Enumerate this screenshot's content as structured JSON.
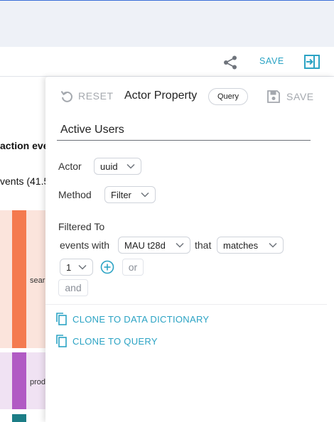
{
  "toolbar": {
    "share_icon": "share-icon",
    "save_label": "SAVE",
    "panel_icon": "panel-collapse-icon"
  },
  "background": {
    "title_fragment": "action eve",
    "subtitle_fragment": "vents (41.5",
    "sankey_labels": [
      "sear",
      "prod"
    ]
  },
  "drawer": {
    "reset_label": "RESET",
    "title": "Actor Property",
    "type_chip": "Query",
    "save_label": "SAVE",
    "name_value": "Active Users",
    "actor_label": "Actor",
    "actor_value": "uuid",
    "method_label": "Method",
    "method_value": "Filter",
    "filtered_to_label": "Filtered To",
    "events_with_label": "events with",
    "event_value": "MAU t28d",
    "that_label": "that",
    "operator_value": "matches",
    "count_value": "1",
    "or_label": "or",
    "and_label": "and",
    "clone_dictionary_label": "CLONE TO DATA DICTIONARY",
    "clone_query_label": "CLONE TO QUERY"
  },
  "colors": {
    "accent": "#2ba3c4",
    "sankey_orange": "#f47a4f",
    "sankey_purple": "#b15ac4",
    "sankey_teal": "#1c7d86"
  }
}
